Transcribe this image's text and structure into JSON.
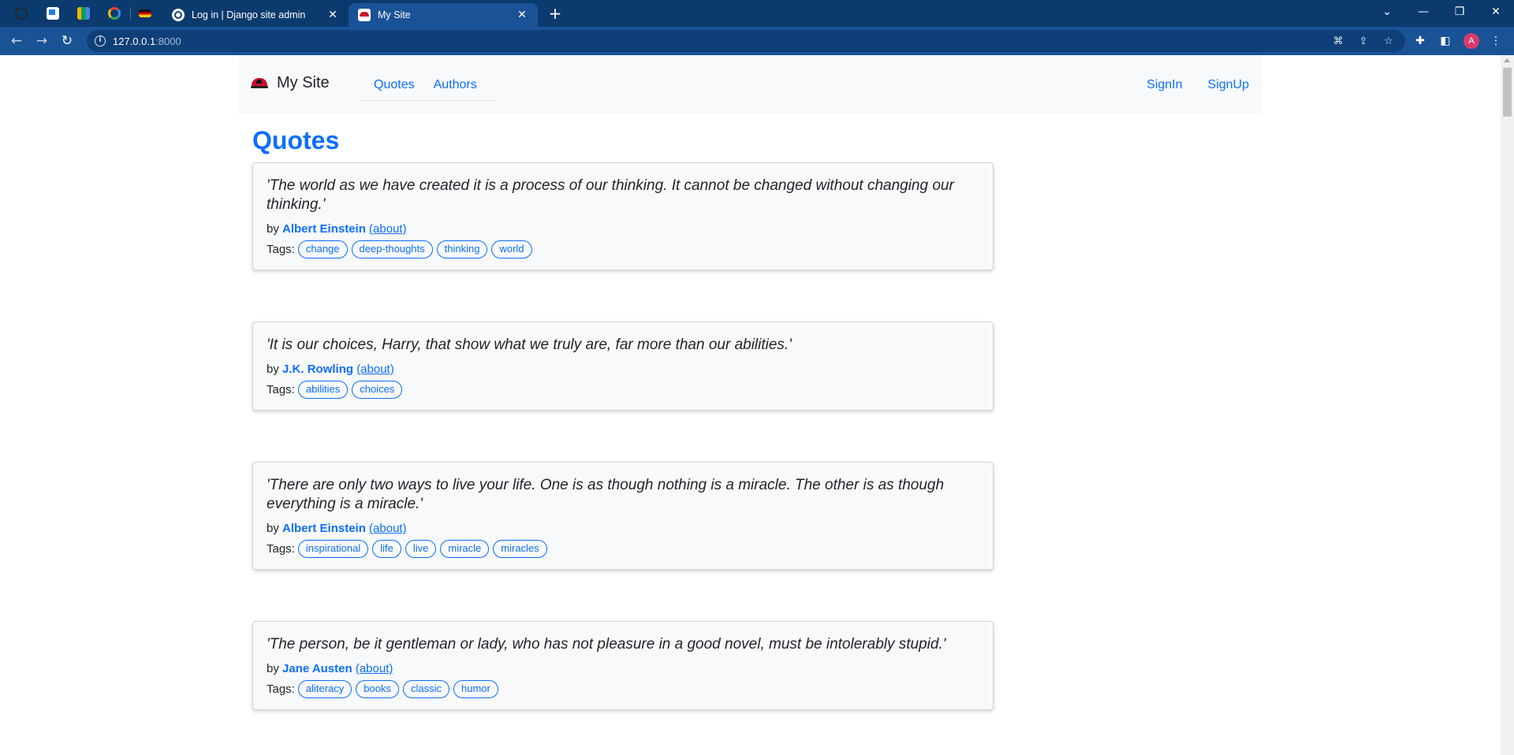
{
  "browser": {
    "tabs": [
      {
        "title": "Log in | Django site admin",
        "close": "✕"
      },
      {
        "title": "My Site",
        "close": "✕"
      }
    ],
    "new_tab": "+",
    "window_controls": {
      "dropdown": "⌄",
      "minimize": "—",
      "restore": "❐",
      "close": "✕"
    },
    "url_host": "127.0.0.1",
    "url_port": ":8000",
    "avatar_letter": "A",
    "accent": "#0b3a6e"
  },
  "site": {
    "brand": "My Site",
    "nav_left": [
      "Quotes",
      "Authors"
    ],
    "nav_right": [
      "SignIn",
      "SignUp"
    ],
    "page_title": "Quotes",
    "link_color": "#0d6efd"
  },
  "quotes": [
    {
      "text": "'The world as we have created it is a process of our thinking. It cannot be changed without changing our thinking.'",
      "by": "by",
      "author": "Albert Einstein",
      "about": "(about)",
      "tags_label": "Tags:",
      "tags": [
        "change",
        "deep-thoughts",
        "thinking",
        "world"
      ]
    },
    {
      "text": "'It is our choices, Harry, that show what we truly are, far more than our abilities.'",
      "by": "by",
      "author": "J.K. Rowling",
      "about": "(about)",
      "tags_label": "Tags:",
      "tags": [
        "abilities",
        "choices"
      ]
    },
    {
      "text": "'There are only two ways to live your life. One is as though nothing is a miracle. The other is as though everything is a miracle.'",
      "by": "by",
      "author": "Albert Einstein",
      "about": "(about)",
      "tags_label": "Tags:",
      "tags": [
        "inspirational",
        "life",
        "live",
        "miracle",
        "miracles"
      ]
    },
    {
      "text": "'The person, be it gentleman or lady, who has not pleasure in a good novel, must be intolerably stupid.'",
      "by": "by",
      "author": "Jane Austen",
      "about": "(about)",
      "tags_label": "Tags:",
      "tags": [
        "aliteracy",
        "books",
        "classic",
        "humor"
      ]
    }
  ]
}
